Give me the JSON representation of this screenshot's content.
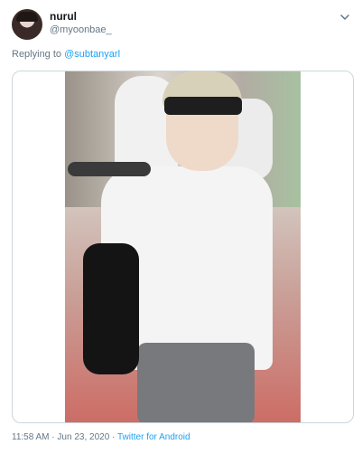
{
  "user": {
    "name": "nurul",
    "handle": "@myoonbae_"
  },
  "reply": {
    "prefix": "Replying to",
    "mention": "@subtanyarl"
  },
  "media": {
    "alt": "Photo of a student in a white school uniform wearing a black headband and carrying a black backpack"
  },
  "meta": {
    "time": "11:58 AM",
    "date": "Jun 23, 2020",
    "separator": "·",
    "source": "Twitter for Android"
  },
  "colors": {
    "link": "#1da1f2",
    "muted": "#657786",
    "border": "#ccd6dd"
  },
  "icons": {
    "menu": "chevron-down-icon"
  }
}
